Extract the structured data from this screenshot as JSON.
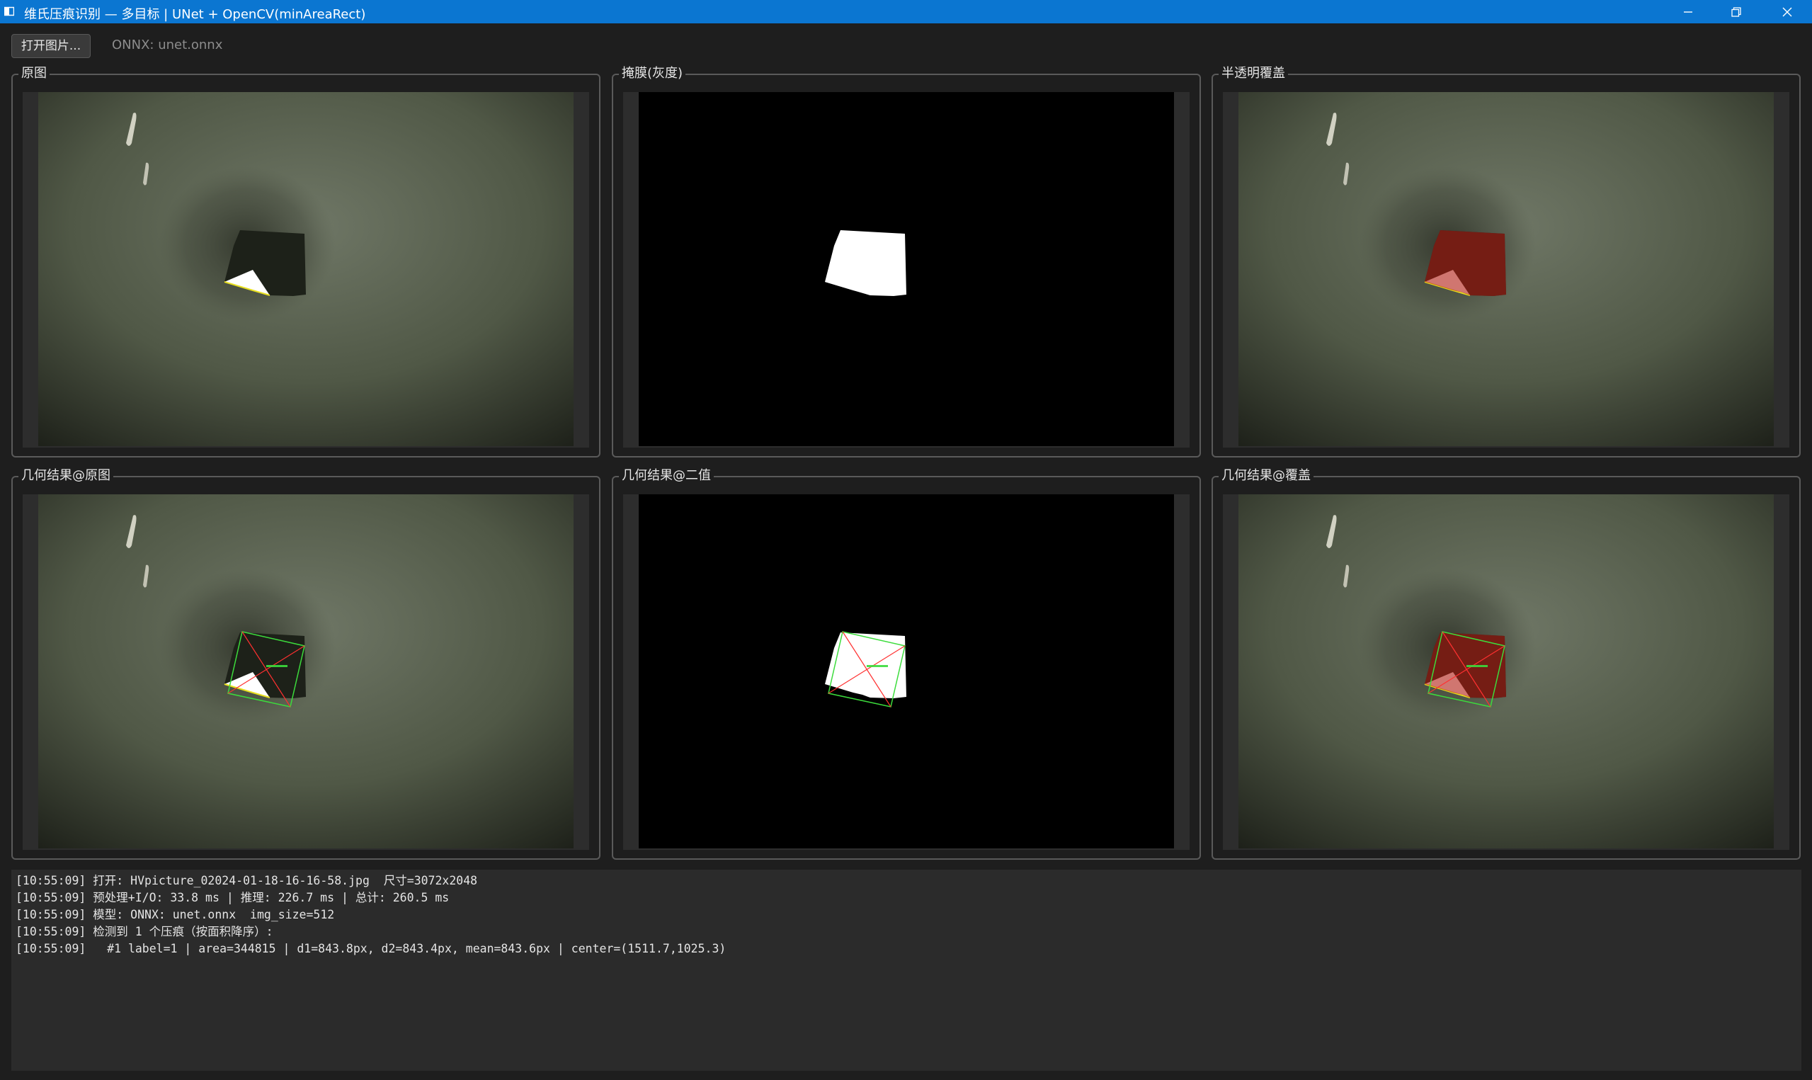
{
  "window": {
    "title": "维氏压痕识别 — 多目标 | UNet + OpenCV(minAreaRect)",
    "controls": [
      "minimize-icon",
      "restore-icon",
      "close-icon"
    ]
  },
  "toolbar": {
    "open_label": "打开图片...",
    "model_label": "ONNX: unet.onnx"
  },
  "panels": [
    {
      "title": "原图",
      "kind": "original"
    },
    {
      "title": "掩膜(灰度)",
      "kind": "mask"
    },
    {
      "title": "半透明覆盖",
      "kind": "overlay"
    },
    {
      "title": "几何结果@原图",
      "kind": "geometry-original"
    },
    {
      "title": "几何结果@二值",
      "kind": "geometry-binary"
    },
    {
      "title": "几何结果@覆盖",
      "kind": "geometry-overlay"
    }
  ],
  "log": [
    "[10:55:09] 打开: HVpicture_02024-01-18-16-16-58.jpg  尺寸=3072x2048",
    "[10:55:09] 预处理+I/O: 33.8 ms | 推理: 226.7 ms | 总计: 260.5 ms",
    "[10:55:09] 模型: ONNX: unet.onnx  img_size=512",
    "[10:55:09] 检测到 1 个压痕（按面积降序）:",
    "[10:55:09]   #1 label=1 | area=344815 | d1=843.8px, d2=843.4px, mean=843.6px | center=(1511.7,1025.3)"
  ],
  "colors": {
    "titlebar": "#0b76d1",
    "background": "#1e1e1e",
    "overlay_red": "#b01a10",
    "contour_green": "#3cdc3c",
    "diagonal_red": "#ff3030"
  }
}
